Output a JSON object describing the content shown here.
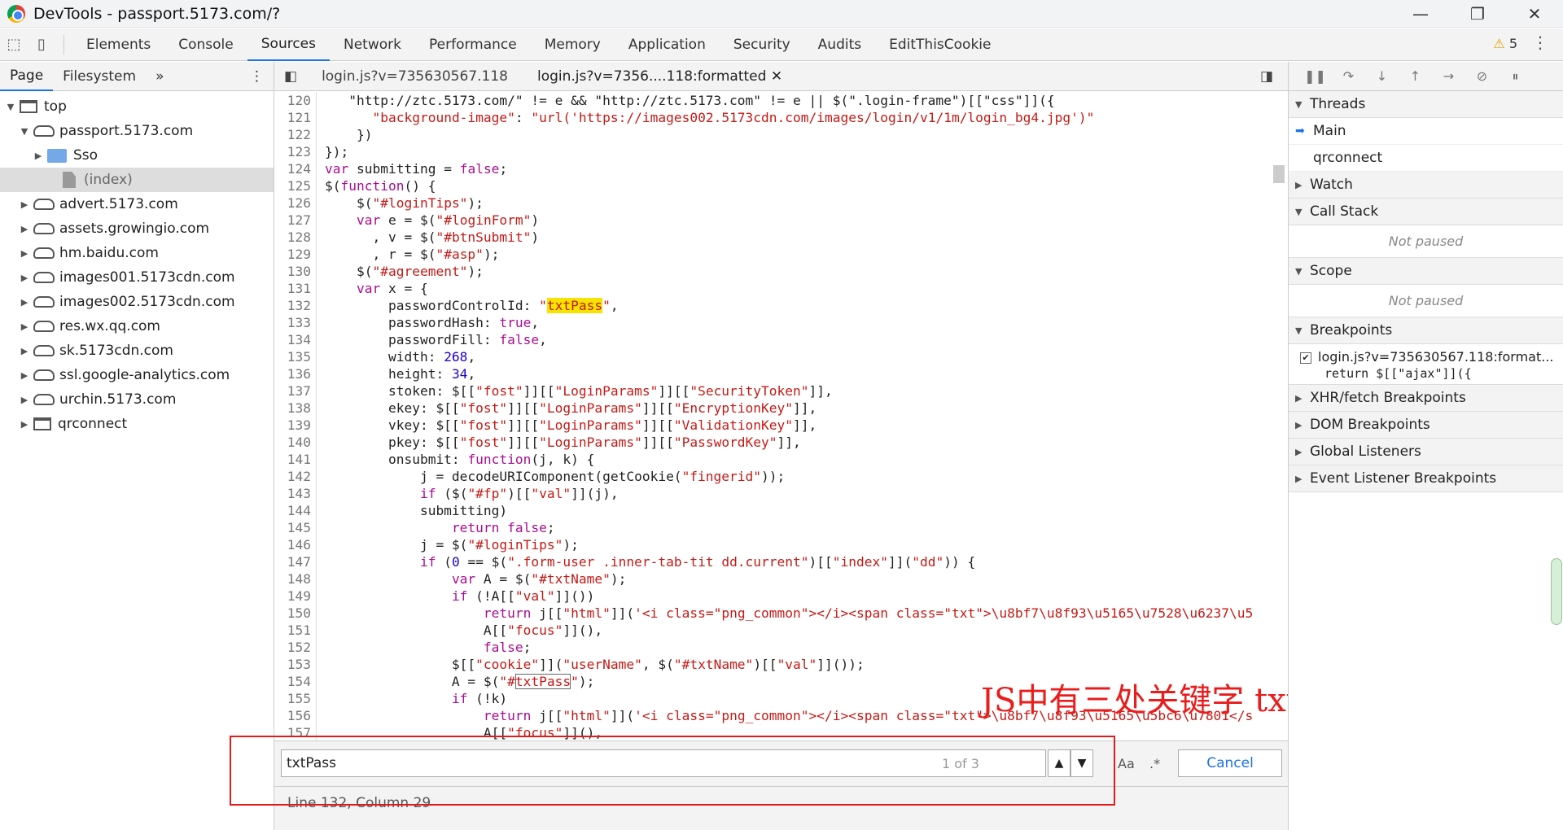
{
  "window": {
    "title": "DevTools - passport.5173.com/?"
  },
  "tabs": [
    "Elements",
    "Console",
    "Sources",
    "Network",
    "Performance",
    "Memory",
    "Application",
    "Security",
    "Audits",
    "EditThisCookie"
  ],
  "active_tab": "Sources",
  "warnings": "5",
  "navigator": {
    "tabs": [
      "Page",
      "Filesystem"
    ],
    "tree": [
      {
        "label": "top",
        "type": "frame",
        "level": 0,
        "open": true
      },
      {
        "label": "passport.5173.com",
        "type": "cloud",
        "level": 1,
        "open": true
      },
      {
        "label": "Sso",
        "type": "folder",
        "level": 2,
        "open": false
      },
      {
        "label": "(index)",
        "type": "file",
        "level": 3,
        "selected": true
      },
      {
        "label": "advert.5173.com",
        "type": "cloud",
        "level": 1
      },
      {
        "label": "assets.growingio.com",
        "type": "cloud",
        "level": 1
      },
      {
        "label": "hm.baidu.com",
        "type": "cloud",
        "level": 1
      },
      {
        "label": "images001.5173cdn.com",
        "type": "cloud",
        "level": 1
      },
      {
        "label": "images002.5173cdn.com",
        "type": "cloud",
        "level": 1
      },
      {
        "label": "res.wx.qq.com",
        "type": "cloud",
        "level": 1
      },
      {
        "label": "sk.5173cdn.com",
        "type": "cloud",
        "level": 1
      },
      {
        "label": "ssl.google-analytics.com",
        "type": "cloud",
        "level": 1
      },
      {
        "label": "urchin.5173.com",
        "type": "cloud",
        "level": 1
      },
      {
        "label": "qrconnect",
        "type": "frame",
        "level": 1
      }
    ]
  },
  "editor": {
    "file_tabs": [
      "login.js?v=735630567.118",
      "login.js?v=7356....118:formatted"
    ],
    "line_numbers": [
      "120",
      "121",
      "122",
      "123",
      "124",
      "125",
      "126",
      "127",
      "128",
      "129",
      "130",
      "131",
      "132",
      "133",
      "134",
      "135",
      "136",
      "137",
      "138",
      "139",
      "140",
      "141",
      "142",
      "143",
      "144",
      "145",
      "146",
      "147",
      "148",
      "149",
      "150",
      "151",
      "152",
      "153",
      "154",
      "155",
      "156",
      "157",
      "158"
    ],
    "search": {
      "value": "txtPass",
      "count": "1 of 3",
      "match_case": "Aa",
      "regex": ".*",
      "cancel": "Cancel"
    },
    "status": "Line 132, Column 29"
  },
  "annotation": "JS中有三处关键字 txtPass",
  "debugger": {
    "threads_label": "Threads",
    "threads": [
      "Main",
      "qrconnect"
    ],
    "watch": "Watch",
    "call_stack": "Call Stack",
    "not_paused": "Not paused",
    "scope": "Scope",
    "breakpoints": "Breakpoints",
    "bp_file": "login.js?v=735630567.118:format...",
    "bp_code": "return $[[\"ajax\"]]({",
    "xhr": "XHR/fetch Breakpoints",
    "dom": "DOM Breakpoints",
    "global": "Global Listeners",
    "event": "Event Listener Breakpoints"
  },
  "colors": {
    "accent": "#1a73e8",
    "annotation": "#ea1c1c",
    "highlight": "#f6e300"
  }
}
